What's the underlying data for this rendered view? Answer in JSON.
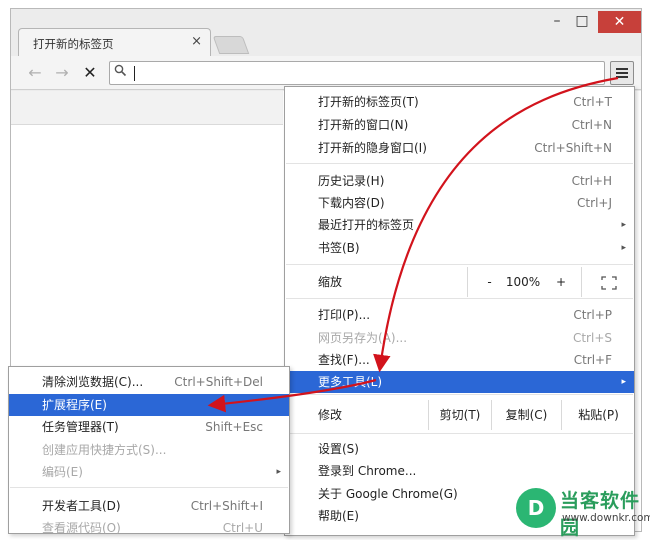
{
  "tab": {
    "title": "打开新的标签页",
    "close": "×"
  },
  "window": {
    "minimize": "–",
    "maximize": "□",
    "close": "✕"
  },
  "nav": {
    "back": "←",
    "forward": "→",
    "stop": "✕",
    "search_icon": "🔍"
  },
  "main_menu": {
    "group1": [
      {
        "label": "打开新的标签页(T)",
        "shortcut": "Ctrl+T"
      },
      {
        "label": "打开新的窗口(N)",
        "shortcut": "Ctrl+N"
      },
      {
        "label": "打开新的隐身窗口(I)",
        "shortcut": "Ctrl+Shift+N"
      }
    ],
    "group2": [
      {
        "label": "历史记录(H)",
        "shortcut": "Ctrl+H"
      },
      {
        "label": "下载内容(D)",
        "shortcut": "Ctrl+J"
      },
      {
        "label": "最近打开的标签页",
        "arrow": "▸"
      },
      {
        "label": "书签(B)",
        "arrow": "▸"
      }
    ],
    "zoom": {
      "label": "缩放",
      "minus": "-",
      "value": "100%",
      "plus": "+",
      "fullscreen": "⛶"
    },
    "group3": [
      {
        "label": "打印(P)...",
        "shortcut": "Ctrl+P"
      },
      {
        "label": "网页另存为(A)...",
        "shortcut": "Ctrl+S",
        "disabled": true
      },
      {
        "label": "查找(F)...",
        "shortcut": "Ctrl+F"
      },
      {
        "label": "更多工具(L)",
        "arrow": "▸",
        "highlighted": true
      }
    ],
    "edit": {
      "label": "修改",
      "cut": "剪切(T)",
      "copy": "复制(C)",
      "paste": "粘贴(P)"
    },
    "group4": [
      {
        "label": "设置(S)"
      },
      {
        "label": "登录到 Chrome..."
      },
      {
        "label": "关于 Google Chrome(G)"
      },
      {
        "label": "帮助(E)"
      }
    ]
  },
  "sub_menu": {
    "items": [
      {
        "label": "清除浏览数据(C)...",
        "shortcut": "Ctrl+Shift+Del"
      },
      {
        "label": "扩展程序(E)",
        "highlighted": true
      },
      {
        "label": "任务管理器(T)",
        "shortcut": "Shift+Esc"
      },
      {
        "label": "创建应用快捷方式(S)...",
        "disabled": true
      },
      {
        "label": "编码(E)",
        "arrow": "▸",
        "disabled": true
      },
      {
        "label": "开发者工具(D)",
        "shortcut": "Ctrl+Shift+I"
      },
      {
        "label": "查看源代码(O)",
        "shortcut": "Ctrl+U"
      }
    ]
  },
  "watermark": {
    "name": "当客软件园",
    "url": "www.downkr.com",
    "glyph": "D"
  },
  "colors": {
    "highlight": "#2b67d6",
    "arrow": "#d2131c",
    "close": "#c7403a",
    "logo": "#2bb673"
  }
}
